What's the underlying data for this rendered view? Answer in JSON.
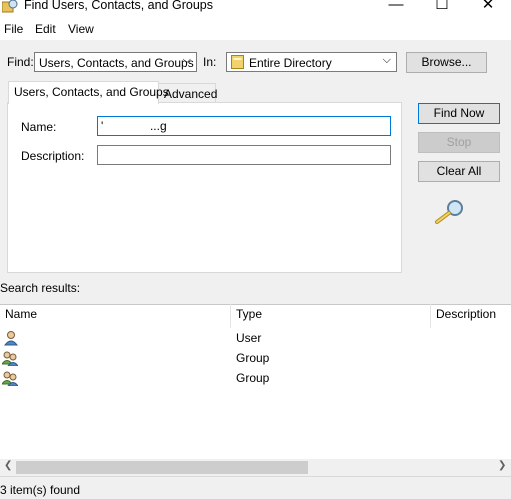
{
  "window": {
    "title": "Find Users, Contacts, and Groups",
    "minimize": "—",
    "maximize": "☐",
    "close": "✕"
  },
  "menu": {
    "items": [
      "File",
      "Edit",
      "View"
    ]
  },
  "find_row": {
    "find_label": "Find:",
    "find_value": "Users, Contacts, and Groups",
    "in_label": "In:",
    "in_value": "Entire Directory",
    "browse_label": "Browse..."
  },
  "tabs": [
    {
      "label": "Users, Contacts, and Groups",
      "active": true
    },
    {
      "label": "Advanced",
      "active": false
    }
  ],
  "form": {
    "name_label": "Name:",
    "name_value": "'              ...g",
    "description_label": "Description:",
    "description_value": ""
  },
  "buttons": {
    "find_now": "Find Now",
    "stop": "Stop",
    "clear_all": "Clear All"
  },
  "results": {
    "label": "Search results:",
    "columns": [
      "Name",
      "Type",
      "Description"
    ],
    "rows": [
      {
        "name": "",
        "type": "User",
        "description": "",
        "icon": "user-icon"
      },
      {
        "name": "",
        "type": "Group",
        "description": "",
        "icon": "group-icon"
      },
      {
        "name": "",
        "type": "Group",
        "description": "",
        "icon": "group-icon"
      }
    ]
  },
  "status": {
    "text": "3 item(s) found"
  },
  "colors": {
    "accent": "#0078d7",
    "window_bg": "#f0f0f0",
    "panel_bg": "#ffffff"
  }
}
